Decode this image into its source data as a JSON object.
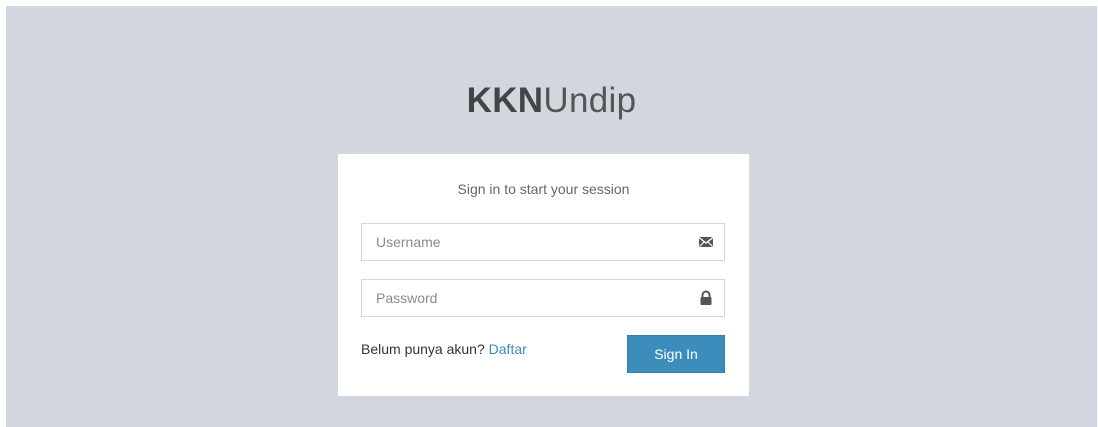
{
  "logo": {
    "bold": "KKN",
    "light": "Undip"
  },
  "login": {
    "message": "Sign in to start your session",
    "username": {
      "placeholder": "Username",
      "value": "",
      "icon": "envelope-icon"
    },
    "password": {
      "placeholder": "Password",
      "value": "",
      "icon": "lock-icon"
    },
    "register_prompt": "Belum punya akun?",
    "register_link": "Daftar",
    "signin_label": "Sign In"
  },
  "colors": {
    "background": "#d2d6de",
    "box": "#ffffff",
    "primary": "#3c8dbc",
    "link": "#3c8dbc"
  }
}
